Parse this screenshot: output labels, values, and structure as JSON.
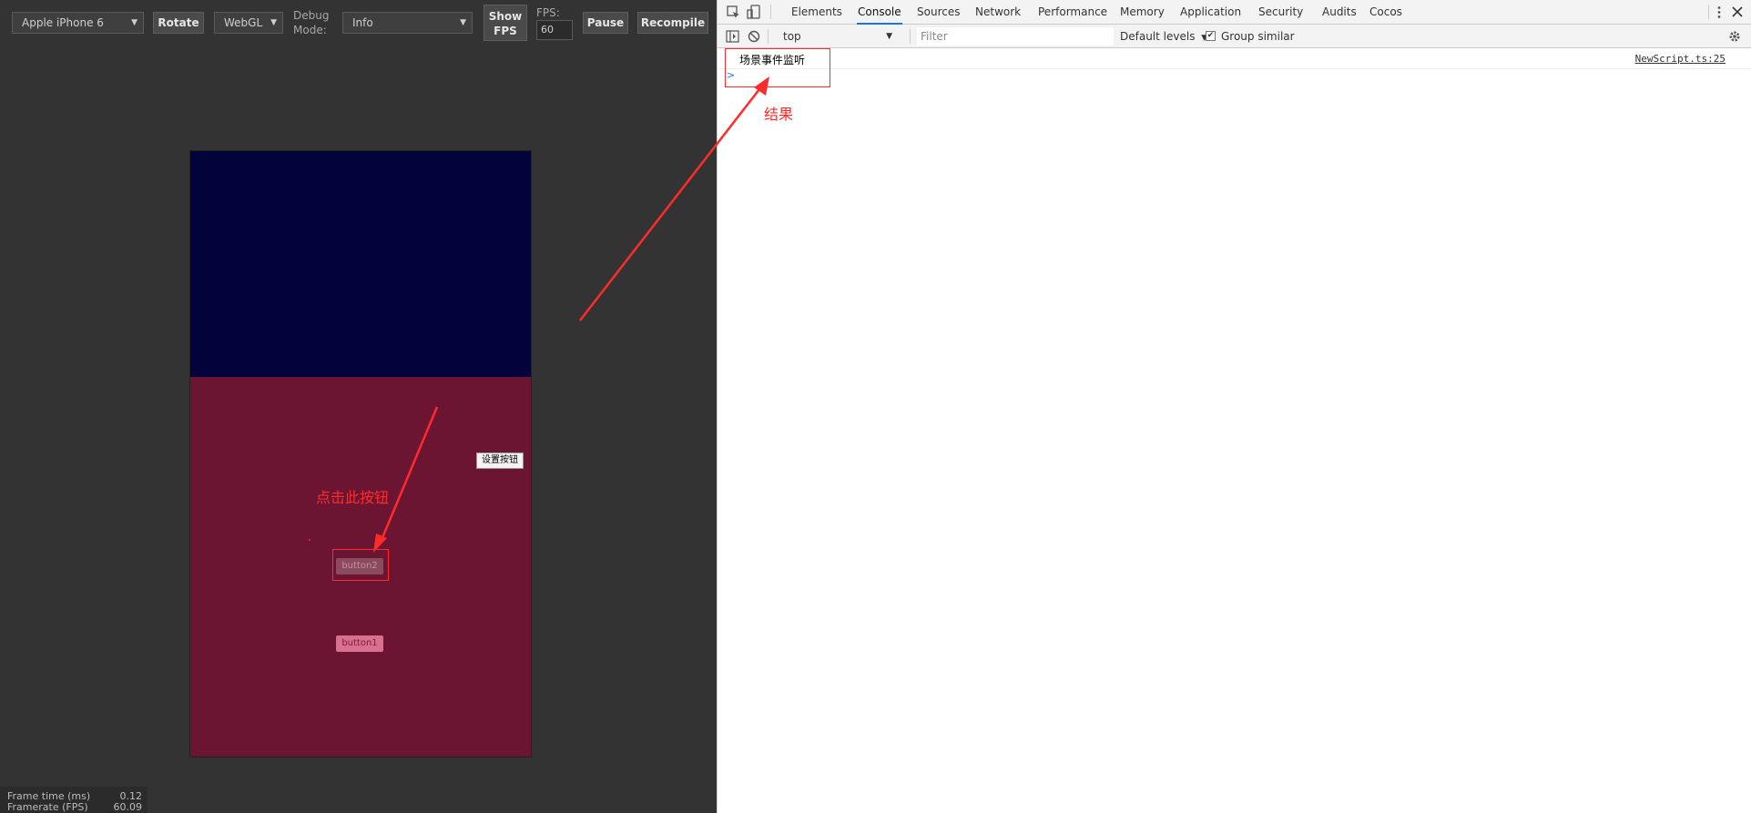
{
  "simulator": {
    "device": "Apple iPhone 6",
    "rotate_label": "Rotate",
    "renderer": "WebGL",
    "debug_mode_label_1": "Debug",
    "debug_mode_label_2": "Mode:",
    "debug_mode_value": "Info",
    "show_fps_label_1": "Show",
    "show_fps_label_2": "FPS",
    "fps_label": "FPS:",
    "fps_value": "60",
    "pause_label": "Pause",
    "recompile_label": "Recompile"
  },
  "game": {
    "set_button_label": "设置按钮",
    "button2_label": "button2",
    "button1_label": "button1",
    "annotation_click": "点击此按钮",
    "colors": {
      "top": "#01033a",
      "bottom": "#6c1532"
    }
  },
  "stats": {
    "frame_time_label": "Frame time (ms)",
    "frame_time_value": "0.12",
    "framerate_label": "Framerate (FPS)",
    "framerate_value": "60.09"
  },
  "devtools": {
    "tabs": [
      "Elements",
      "Console",
      "Sources",
      "Network",
      "Performance",
      "Memory",
      "Application",
      "Security",
      "Audits",
      "Cocos"
    ],
    "active_tab": "Console",
    "context": "top",
    "filter_placeholder": "Filter",
    "levels_label": "Default levels",
    "group_similar_label": "Group similar",
    "log_message": "场景事件监听",
    "log_source": "NewScript.ts:25",
    "prompt": ">",
    "annotation_result": "结果"
  },
  "colors": {
    "annotation": "#ff2b2b",
    "tab_accent": "#1a73e8"
  }
}
